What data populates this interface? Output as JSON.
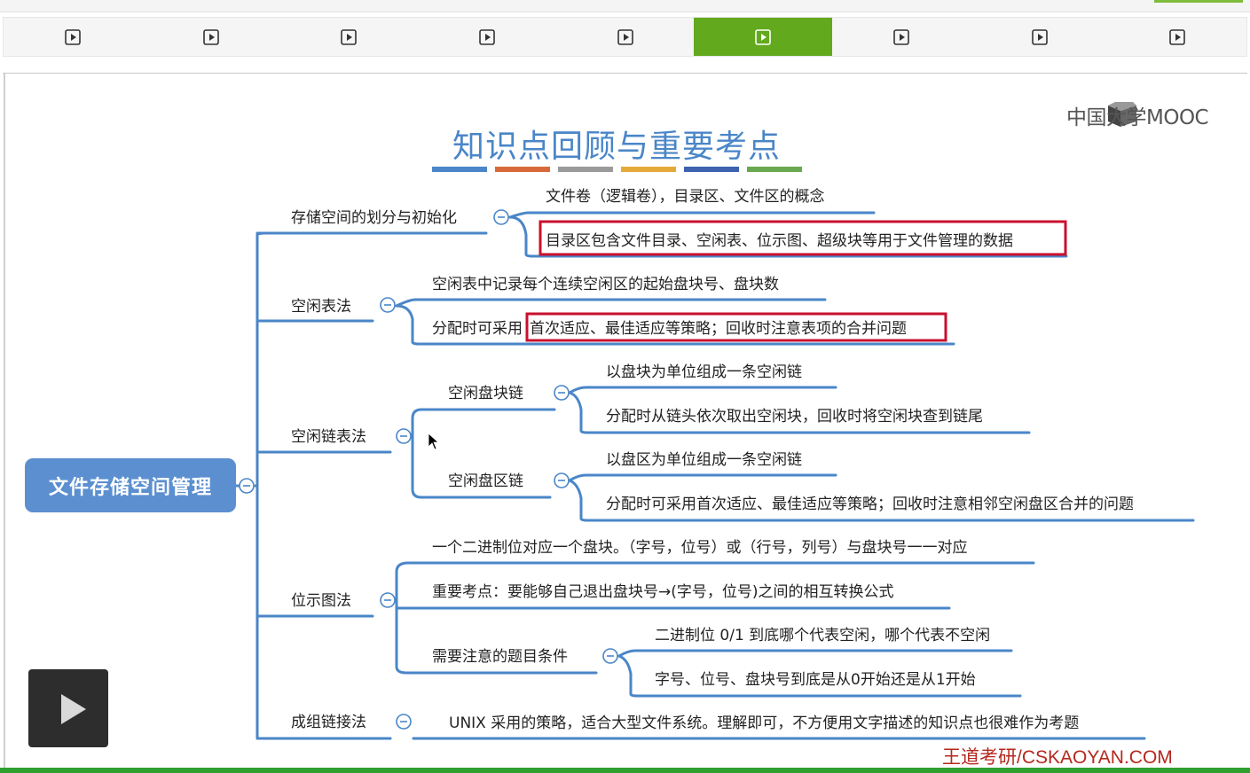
{
  "tabs": [
    {
      "icon": "play-icon",
      "active": false
    },
    {
      "icon": "play-icon",
      "active": false
    },
    {
      "icon": "play-icon",
      "active": false
    },
    {
      "icon": "play-icon",
      "active": false
    },
    {
      "icon": "play-icon",
      "active": false
    },
    {
      "icon": "play-icon",
      "active": true
    },
    {
      "icon": "play-icon",
      "active": false
    },
    {
      "icon": "play-icon",
      "active": false
    },
    {
      "icon": "play-icon",
      "active": false
    }
  ],
  "colors": {
    "accent": "#62a91d",
    "root": "#5b8fd0",
    "title": "#4a86c8",
    "highlight": "#c8102e",
    "line": "#4a86c8",
    "footer": "#b5281e"
  },
  "slide": {
    "logo": "中国大学MOOC",
    "title": "知识点回顾与重要考点",
    "title_bar_colors": [
      "#4a86c8",
      "#d9693b",
      "#9a9a9a",
      "#e5a93a",
      "#3e62b0",
      "#6aa84f"
    ],
    "root": "文件存储空间管理",
    "branches": {
      "b1": {
        "label": "存储空间的划分与初始化",
        "items": [
          "文件卷（逻辑卷），目录区、文件区的概念",
          "目录区包含文件目录、空闲表、位示图、超级块等用于文件管理的数据"
        ]
      },
      "b2": {
        "label": "空闲表法",
        "items": [
          "空闲表中记录每个连续空闲区的起始盘块号、盘块数",
          "分配时可采用",
          "首次适应、最佳适应等策略；回收时注意表项的合并问题"
        ]
      },
      "b3": {
        "label": "空闲链表法",
        "sub1": {
          "label": "空闲盘块链",
          "items": [
            "以盘块为单位组成一条空闲链",
            "分配时从链头依次取出空闲块，回收时将空闲块查到链尾"
          ]
        },
        "sub2": {
          "label": "空闲盘区链",
          "items": [
            "以盘区为单位组成一条空闲链",
            "分配时可采用首次适应、最佳适应等策略；回收时注意相邻空闲盘区合并的问题"
          ]
        }
      },
      "b4": {
        "label": "位示图法",
        "items": [
          "一个二进制位对应一个盘块。（字号，位号）或（行号，列号）与盘块号一一对应",
          "重要考点：要能够自己退出盘块号→(字号，位号)之间的相互转换公式"
        ],
        "sub": {
          "label": "需要注意的题目条件",
          "items": [
            "二进制位 0/1 到底哪个代表空闲，哪个代表不空闲",
            "字号、位号、盘块号到底是从0开始还是从1开始"
          ]
        }
      },
      "b5": {
        "label": "成组链接法",
        "items": [
          "UNIX 采用的策略，适合大型文件系统。理解即可，不方便用文字描述的知识点也很难作为考题"
        ]
      }
    },
    "footer": "王道考研/CSKAOYAN.COM"
  }
}
